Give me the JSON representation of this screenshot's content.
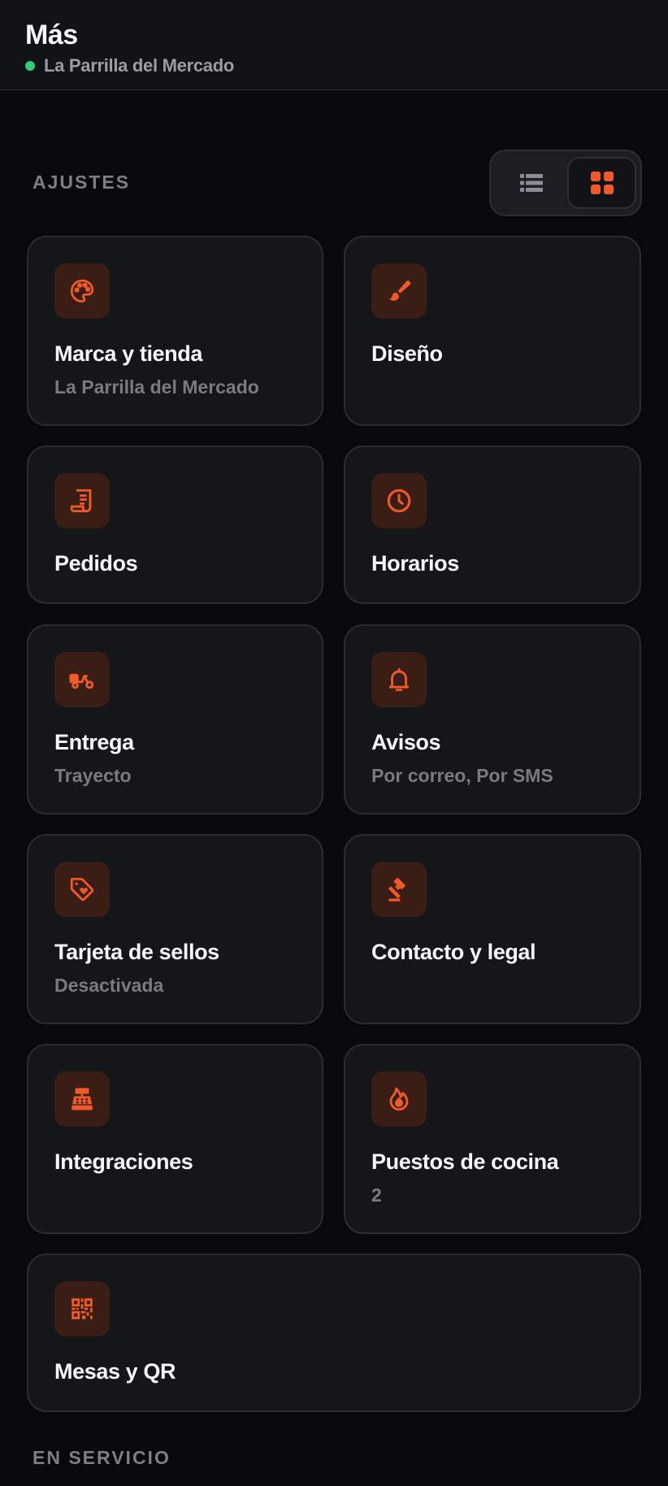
{
  "header": {
    "title": "Más",
    "store_name": "La Parrilla del Mercado",
    "status_color": "#2fcf7e"
  },
  "sections": {
    "settings_label": "AJUSTES",
    "service_label": "EN SERVICIO"
  },
  "view_toggle": {
    "options": [
      "list",
      "grid"
    ],
    "selected": "grid"
  },
  "theme": {
    "accent": "#f05a28",
    "icon_bg": "#3a1e16",
    "card_bg": "#15161a"
  },
  "cards": [
    {
      "title": "Marca y tienda",
      "subtitle": "La Parrilla del Mercado",
      "icon": "palette-icon"
    },
    {
      "title": "Diseño",
      "subtitle": "",
      "icon": "paintbrush-icon"
    },
    {
      "title": "Pedidos",
      "subtitle": "",
      "icon": "receipt-icon"
    },
    {
      "title": "Horarios",
      "subtitle": "",
      "icon": "clock-icon"
    },
    {
      "title": "Entrega",
      "subtitle": "Trayecto",
      "icon": "scooter-icon"
    },
    {
      "title": "Avisos",
      "subtitle": "Por correo, Por SMS",
      "icon": "bell-icon"
    },
    {
      "title": "Tarjeta de sellos",
      "subtitle": "Desactivada",
      "icon": "tag-heart-icon"
    },
    {
      "title": "Contacto y legal",
      "subtitle": "",
      "icon": "gavel-icon"
    },
    {
      "title": "Integraciones",
      "subtitle": "",
      "icon": "cash-register-icon"
    },
    {
      "title": "Puestos de cocina",
      "subtitle": "2",
      "icon": "fire-icon"
    },
    {
      "title": "Mesas y QR",
      "subtitle": "",
      "icon": "qr-code-icon"
    }
  ]
}
